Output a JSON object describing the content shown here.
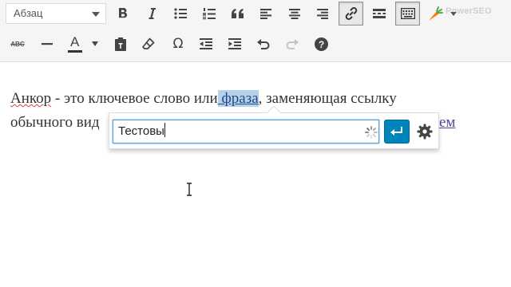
{
  "toolbar": {
    "format_select": {
      "value": "Абзац"
    },
    "row1_buttons": [
      {
        "icon": "bold-icon"
      },
      {
        "icon": "italic-icon"
      },
      {
        "icon": "bulleted-list-icon"
      },
      {
        "icon": "numbered-list-icon"
      },
      {
        "icon": "blockquote-icon"
      },
      {
        "icon": "align-left-icon"
      },
      {
        "icon": "align-center-icon"
      },
      {
        "icon": "align-right-icon"
      },
      {
        "icon": "insert-link-icon",
        "active": true
      },
      {
        "icon": "read-more-icon"
      },
      {
        "icon": "toolbar-toggle-icon",
        "active": true
      }
    ],
    "plugin_logo_text": "PowerSEO",
    "row2_buttons": [
      {
        "icon": "strikethrough-icon",
        "label": "ABC"
      },
      {
        "icon": "horizontal-line-icon"
      },
      {
        "icon": "text-color-icon",
        "label": "A"
      },
      {
        "icon": "paste-as-text-icon"
      },
      {
        "icon": "clear-formatting-icon"
      },
      {
        "icon": "special-character-icon",
        "label": "Ω"
      },
      {
        "icon": "outdent-icon"
      },
      {
        "icon": "indent-icon"
      },
      {
        "icon": "undo-icon"
      },
      {
        "icon": "redo-icon"
      },
      {
        "icon": "help-icon"
      }
    ]
  },
  "content": {
    "line1": {
      "word_anchor": "Анкор",
      "dash": " - ",
      "before_selection": "это ключевое слово или",
      "selection": " фраза",
      "after_selection": ", заменяющая ссылку"
    },
    "line2": {
      "start": "обычного вид",
      "link_end": "ем"
    }
  },
  "link_popup": {
    "url_value": "Тестовы",
    "apply_icon": "enter-arrow-icon",
    "settings_icon": "gear-icon",
    "loading_icon": "spinner-icon"
  },
  "colors": {
    "accent": "#0085ba",
    "selection_bg": "#b6d1ea",
    "toolbar_bg": "#f5f5f5",
    "logo_orange": "#f57c00"
  }
}
